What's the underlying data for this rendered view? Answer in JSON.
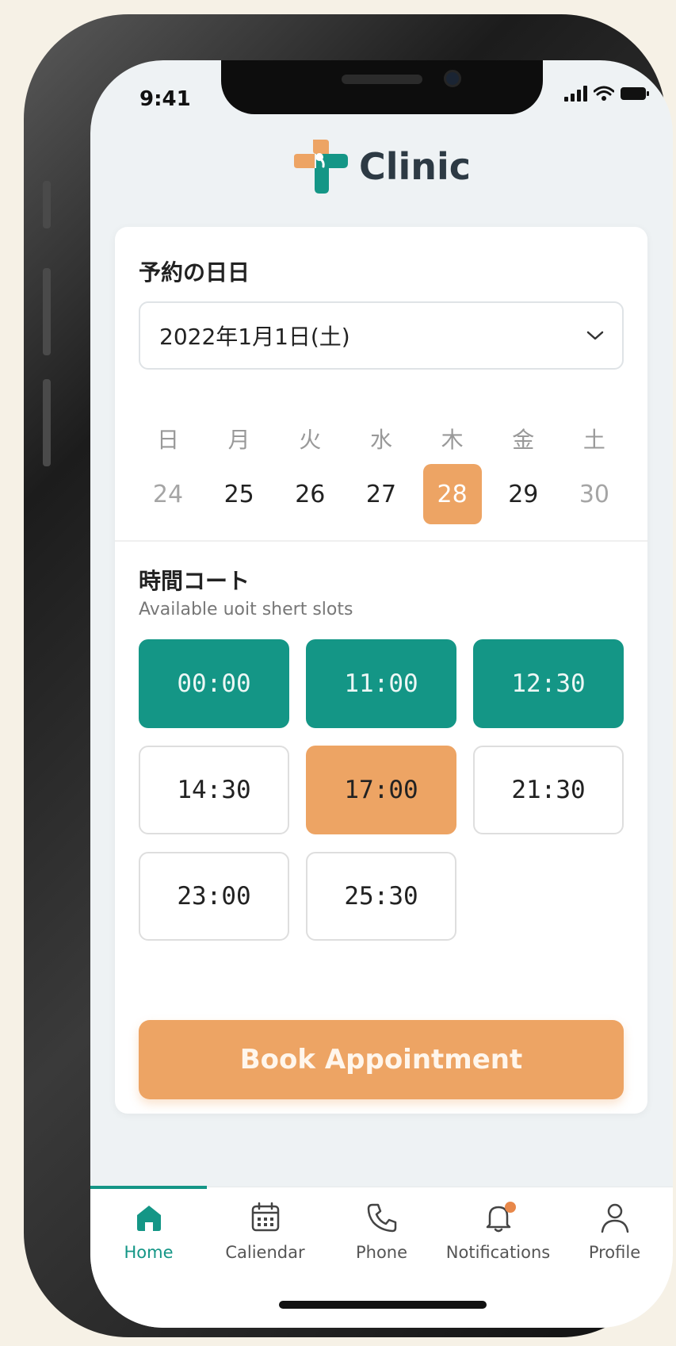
{
  "status_bar": {
    "time": "9:41"
  },
  "header": {
    "app_name": "Clinic"
  },
  "booking": {
    "date_section_title": "予約の日日",
    "selected_date": "2022年1月1日(土)",
    "weekdays": [
      "日",
      "月",
      "火",
      "水",
      "木",
      "金",
      "土"
    ],
    "days": [
      {
        "label": "24",
        "state": "muted"
      },
      {
        "label": "25",
        "state": "normal"
      },
      {
        "label": "26",
        "state": "normal"
      },
      {
        "label": "27",
        "state": "normal"
      },
      {
        "label": "28",
        "state": "selected"
      },
      {
        "label": "29",
        "state": "normal"
      },
      {
        "label": "30",
        "state": "muted"
      }
    ],
    "time_section_title": "時間コート",
    "time_section_subtitle": "Available uoit shert slots",
    "slots": [
      {
        "time": "00:00",
        "state": "available"
      },
      {
        "time": "11:00",
        "state": "available"
      },
      {
        "time": "12:30",
        "state": "available"
      },
      {
        "time": "14:30",
        "state": "open"
      },
      {
        "time": "17:00",
        "state": "selected"
      },
      {
        "time": "21:30",
        "state": "open"
      },
      {
        "time": "23:00",
        "state": "open"
      },
      {
        "time": "25:30",
        "state": "open"
      }
    ],
    "book_button_label": "Book Appointment"
  },
  "tabbar": {
    "tabs": [
      {
        "label": "Home",
        "icon": "home-icon",
        "active": true
      },
      {
        "label": "Caliendar",
        "icon": "calendar-icon",
        "active": false
      },
      {
        "label": "Phone",
        "icon": "phone-icon",
        "active": false
      },
      {
        "label": "Notifications",
        "icon": "bell-icon",
        "active": false,
        "badge": true
      },
      {
        "label": "Profile",
        "icon": "profile-icon",
        "active": false
      }
    ]
  },
  "colors": {
    "primary_teal": "#149686",
    "accent_orange": "#eda464",
    "notification_dot": "#e8884a",
    "screen_background": "#eef2f4"
  }
}
